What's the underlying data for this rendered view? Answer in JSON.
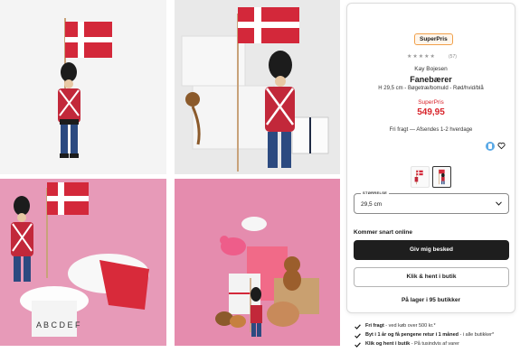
{
  "badge": "SuperPris",
  "rating": {
    "stars": "★★★★★",
    "count": "(57)"
  },
  "product": {
    "brand": "Kay Bojesen",
    "title": "Fanebærer",
    "description": "H 29,5 cm - Bøgetræ/bomuld - Rød/hvid/blå",
    "sale_label": "SuperPris",
    "price": "549,95"
  },
  "shipping_line": "Fri fragt — Afsendes 1-2 hverdage",
  "size_select": {
    "label": "STØRRELSE",
    "value": "29,5 cm"
  },
  "availability": "Kommer snart online",
  "buttons": {
    "notify": "Giv mig besked",
    "click_collect": "Klik & hent i butik",
    "stock": "På lager i 95 butikker"
  },
  "usps": [
    {
      "bold": "Fri fragt",
      "text": " - ved køb over 500 kr.*"
    },
    {
      "bold": "Byt i 1 år og få pengene retur i 1 måned",
      "text": " - i alle butikker*"
    },
    {
      "bold": "Klik og hent i butik",
      "text": " - På tusindvis af varer"
    }
  ],
  "colors": {
    "accent_red": "#d8232a",
    "badge_border": "#f0a04a",
    "button_dark": "#1e1e1e"
  },
  "icons": [
    "mobilepay-icon",
    "heart-icon",
    "chevron-down-icon",
    "check-icon"
  ]
}
